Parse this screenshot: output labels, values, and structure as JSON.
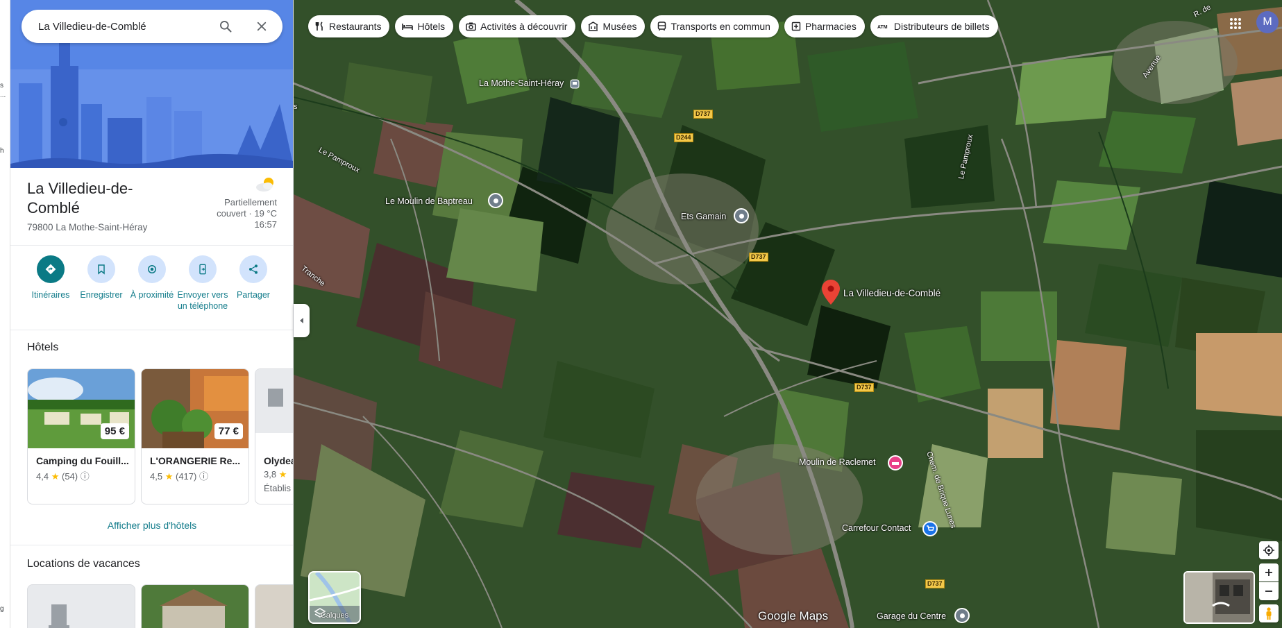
{
  "search": {
    "value": "La Villedieu-de-Comblé"
  },
  "edge_strip": [
    "s",
    "...",
    "h",
    "g"
  ],
  "place": {
    "title": "La Villedieu-de-Comblé",
    "address": "79800 La Mothe-Saint-Héray",
    "weather_line1": "Partiellement",
    "weather_line2": "couvert · 19 °C",
    "weather_time": "16:57",
    "weather_icon": "partly-cloudy-icon"
  },
  "actions": [
    {
      "label": "Itinéraires",
      "icon": "directions-icon"
    },
    {
      "label": "Enregistrer",
      "icon": "bookmark-icon"
    },
    {
      "label": "À proximité",
      "icon": "nearby-icon"
    },
    {
      "label": "Envoyer vers un téléphone",
      "icon": "send-to-phone-icon"
    },
    {
      "label": "Partager",
      "icon": "share-icon"
    }
  ],
  "hotels": {
    "heading": "Hôtels",
    "items": [
      {
        "name": "Camping du Fouill...",
        "rating": "4,4",
        "reviews": "(54)",
        "price": "95 €",
        "sub": ""
      },
      {
        "name": "L'ORANGERIE Re...",
        "rating": "4,5",
        "reviews": "(417)",
        "price": "77 €",
        "sub": ""
      },
      {
        "name": "Olydea",
        "rating": "3,8",
        "reviews": "",
        "price": "",
        "sub": "Établis"
      }
    ],
    "more": "Afficher plus d'hôtels"
  },
  "vacation": {
    "heading": "Locations de vacances"
  },
  "chips": [
    {
      "label": "Restaurants",
      "icon": "fork-knife-icon"
    },
    {
      "label": "Hôtels",
      "icon": "bed-icon"
    },
    {
      "label": "Activités à découvrir",
      "icon": "camera-icon"
    },
    {
      "label": "Musées",
      "icon": "museum-icon"
    },
    {
      "label": "Transports en commun",
      "icon": "bus-icon"
    },
    {
      "label": "Pharmacies",
      "icon": "pharmacy-icon"
    },
    {
      "label": "Distributeurs de billets",
      "icon": "atm-icon"
    }
  ],
  "account": {
    "initial": "M"
  },
  "map": {
    "place_labels": {
      "mothe": "La Mothe-Saint-Héray",
      "moulin_baptreau": "Le Moulin de Baptreau",
      "ets_gamain": "Ets Gamain",
      "villedieu": "La Villedieu-de-Comblé",
      "moulin_raclemet": "Moulin de Raclemet",
      "carrefour": "Carrefour Contact",
      "garage": "Garage du Centre"
    },
    "road_labels": {
      "pamproux_w": "Le Pamproux",
      "pamproux_e": "Le Pamproux",
      "tranche": "Tranche",
      "chem_brique": "Chem. de Brique Lunes",
      "ruedes": "R. de",
      "avenue": "Avenue",
      "road_s": "s"
    },
    "road_tags": [
      "D737",
      "D244",
      "D737",
      "D737",
      "D737"
    ],
    "layers_label": "Calques",
    "logo": "Google Maps"
  }
}
